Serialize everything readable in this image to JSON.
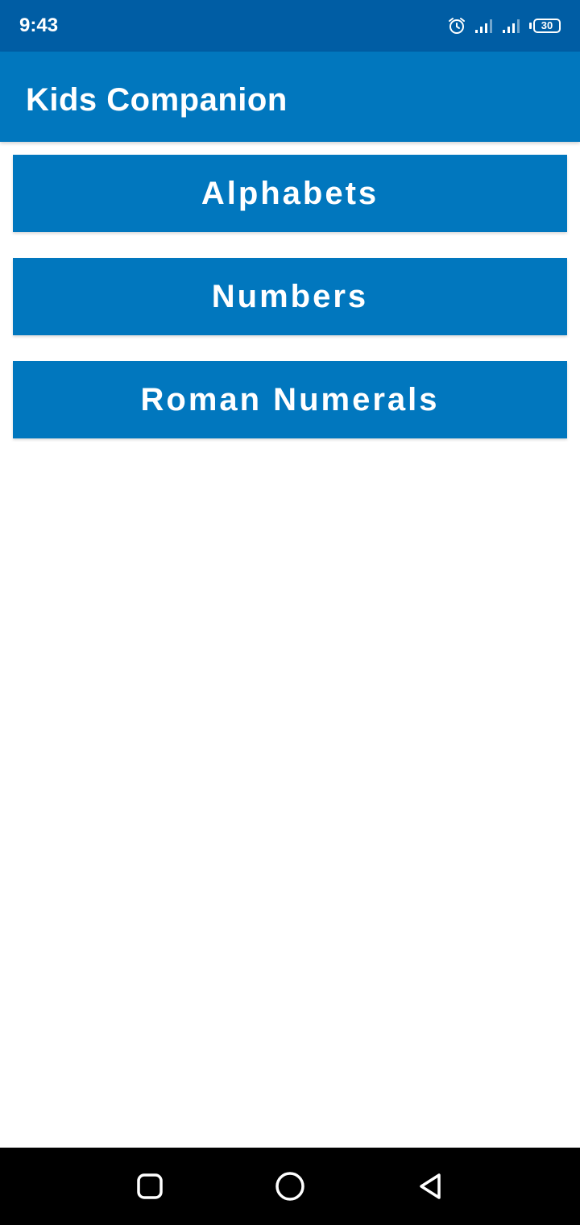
{
  "status_bar": {
    "time": "9:43",
    "battery": "30",
    "icons": [
      "alarm-icon",
      "signal-icon",
      "signal-icon",
      "battery-icon"
    ]
  },
  "app_bar": {
    "title": "Kids Companion"
  },
  "menu": {
    "items": [
      {
        "label": "Alphabets"
      },
      {
        "label": "Numbers"
      },
      {
        "label": "Roman Numerals"
      }
    ]
  },
  "nav_bar": {
    "icons": [
      "recents-square-icon",
      "home-circle-icon",
      "back-triangle-icon"
    ]
  },
  "colors": {
    "status_bar": "#005da4",
    "primary": "#0177be",
    "background": "#ffffff",
    "nav_bar": "#000000"
  }
}
